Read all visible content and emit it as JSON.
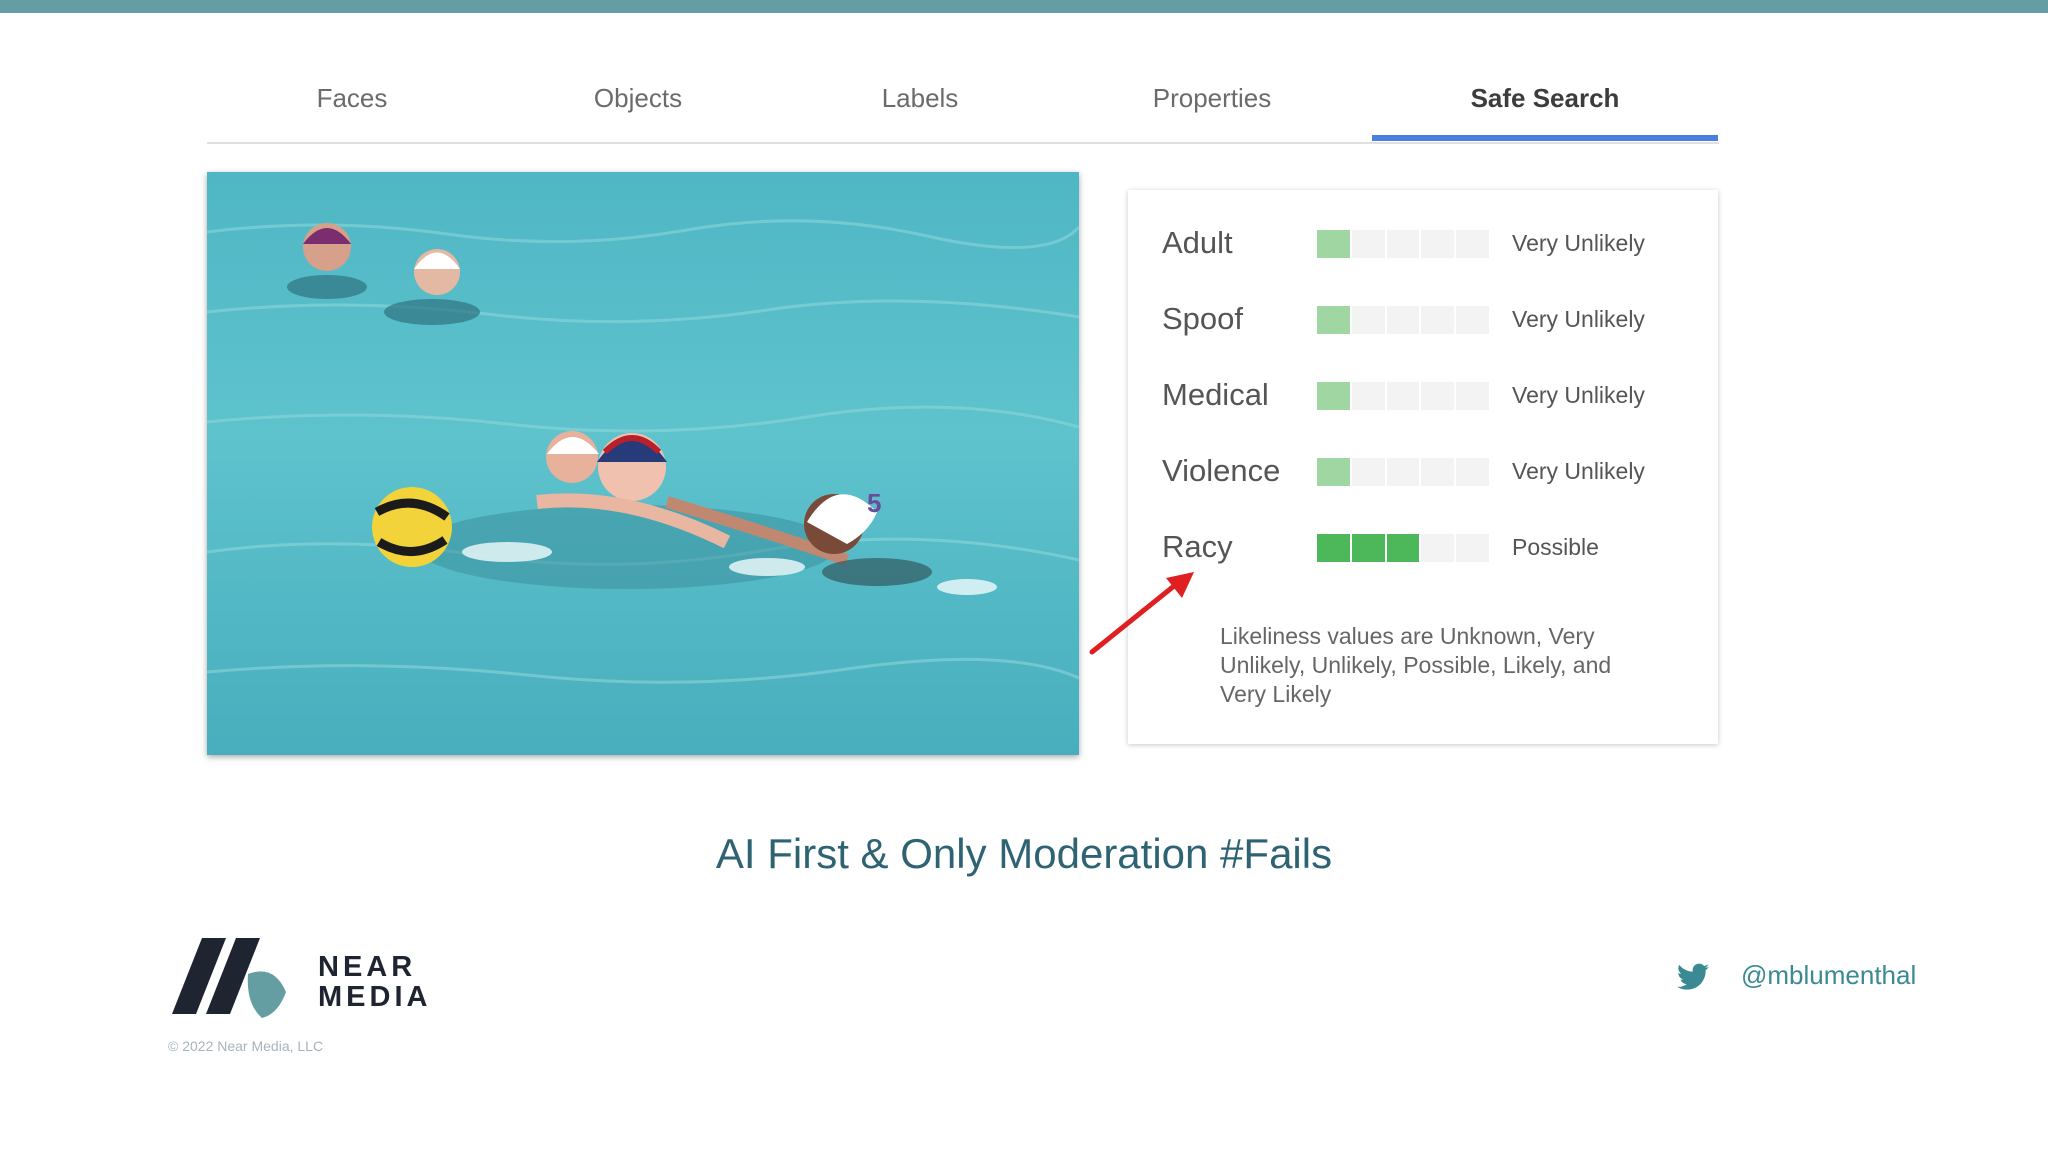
{
  "tabs": [
    {
      "label": "Faces",
      "active": false
    },
    {
      "label": "Objects",
      "active": false
    },
    {
      "label": "Labels",
      "active": false
    },
    {
      "label": "Properties",
      "active": false
    },
    {
      "label": "Safe Search",
      "active": true
    }
  ],
  "safe_search": {
    "rows": [
      {
        "label": "Adult",
        "value": "Very Unlikely",
        "level": 1,
        "max_level": 5
      },
      {
        "label": "Spoof",
        "value": "Very Unlikely",
        "level": 1,
        "max_level": 5
      },
      {
        "label": "Medical",
        "value": "Very Unlikely",
        "level": 1,
        "max_level": 5
      },
      {
        "label": "Violence",
        "value": "Very Unlikely",
        "level": 1,
        "max_level": 5
      },
      {
        "label": "Racy",
        "value": "Possible",
        "level": 3,
        "max_level": 5
      }
    ],
    "footnote": "Likeliness values are Unknown, Very Unlikely, Unlikely, Possible, Likely, and Very Likely"
  },
  "caption": "AI First & Only Moderation #Fails",
  "brand": {
    "line1": "NEAR",
    "line2": "MEDIA",
    "copyright": "© 2022 Near Media, LLC"
  },
  "social": {
    "icon": "twitter-icon",
    "handle": "@mblumenthal"
  },
  "colors": {
    "accent_bar": "#649ea2",
    "tab_indicator": "#4a7fe0",
    "level_light": "#9fd6a1",
    "level_strong": "#4cb85a",
    "caption": "#2e6373",
    "arrow": "#e02020"
  }
}
